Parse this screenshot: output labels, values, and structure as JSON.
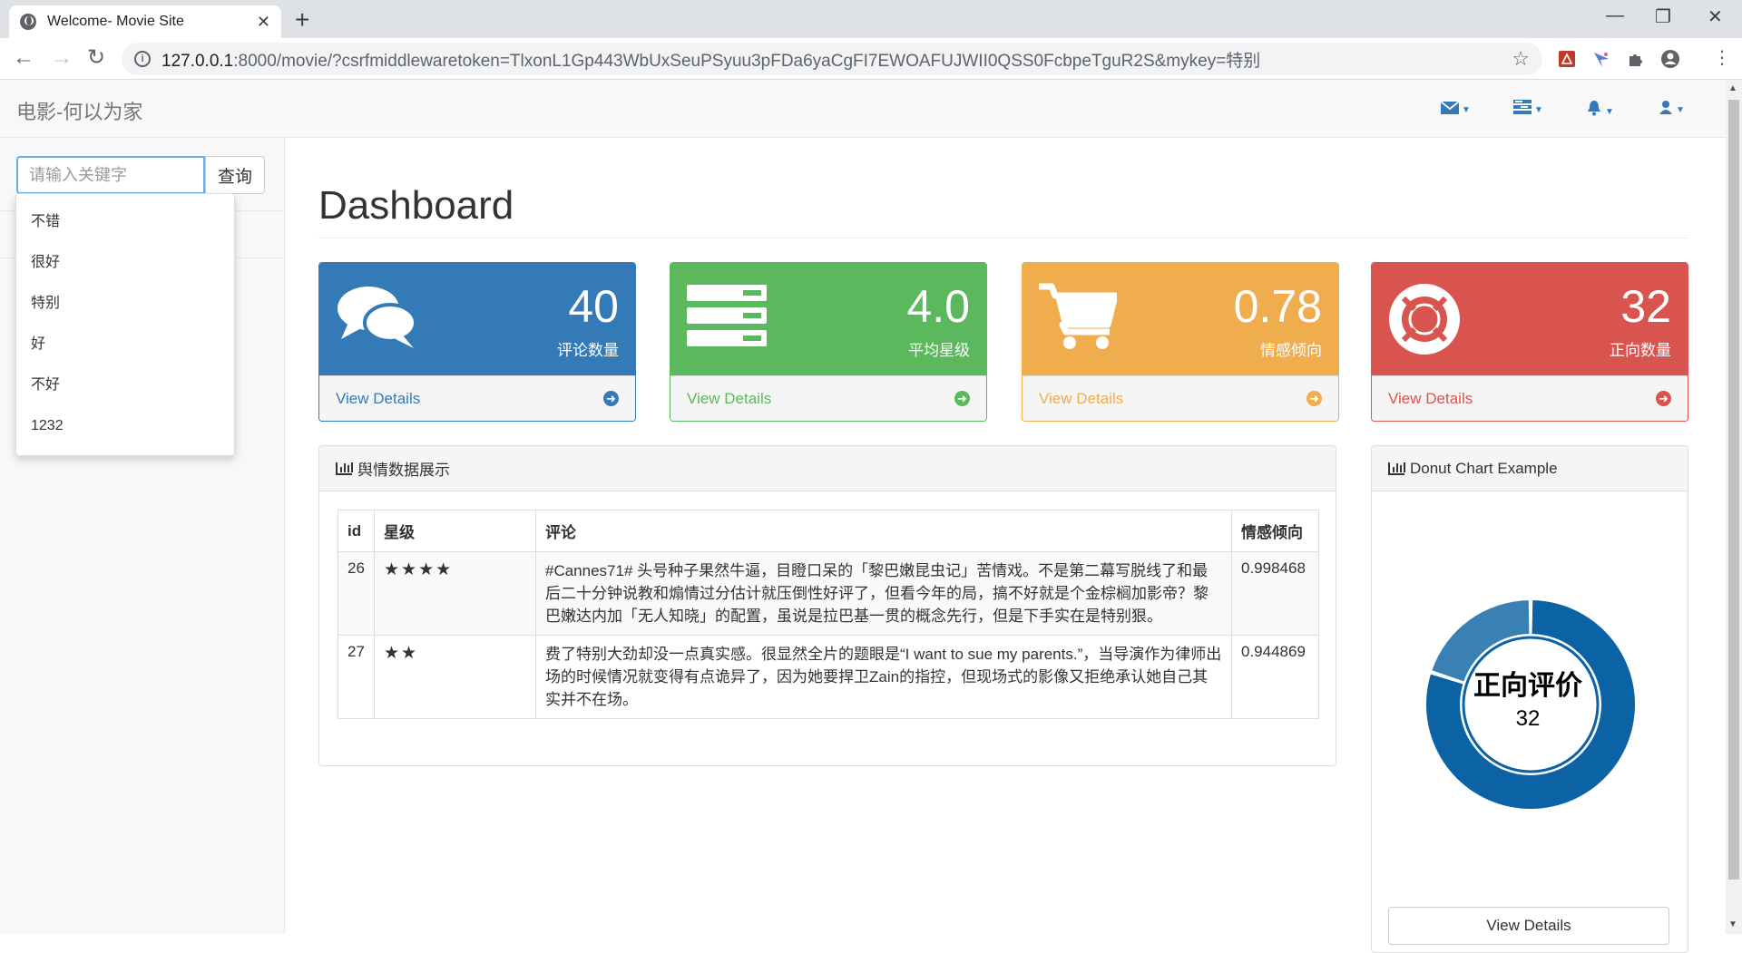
{
  "browser": {
    "tab_title": "Welcome- Movie Site",
    "tab_close": "✕",
    "new_tab": "+",
    "url_host": "127.0.0.1",
    "url_rest": ":8000/movie/?csrfmiddlewaretoken=TlxonL1Gp443WbUxSeuPSyuu3pFDa6yaCgFI7EWOAFUJWII0QSS0FcbpeTguR2S&mykey=特别",
    "minimize": "—",
    "maximize": "❐",
    "close": "✕"
  },
  "navbar": {
    "brand": "电影-何以为家",
    "icons": [
      "envelope-icon",
      "tasks-icon",
      "bell-icon",
      "user-icon"
    ]
  },
  "search": {
    "placeholder": "请输入关键字",
    "button_label": "查询",
    "suggestions": [
      "不错",
      "很好",
      "特别",
      "好",
      "不好",
      "1232"
    ]
  },
  "page_title": "Dashboard",
  "stats": [
    {
      "value": "40",
      "label": "评论数量",
      "link": "View Details",
      "color": "#337ab7",
      "icon": "comments-icon"
    },
    {
      "value": "4.0",
      "label": "平均星级",
      "link": "View Details",
      "color": "#5cb85c",
      "icon": "tasks-icon"
    },
    {
      "value": "0.78",
      "label": "情感倾向",
      "link": "View Details",
      "color": "#f0ad4e",
      "icon": "shopping-cart-icon"
    },
    {
      "value": "32",
      "label": "正向数量",
      "link": "View Details",
      "color": "#d9534f",
      "icon": "life-ring-icon"
    }
  ],
  "table_panel": {
    "heading": "舆情数据展示",
    "columns": [
      "id",
      "星级",
      "评论",
      "情感倾向"
    ],
    "rows": [
      {
        "id": "26",
        "stars": 4,
        "comment": "#Cannes71# 头号种子果然牛逼，目瞪口呆的「黎巴嫩昆虫记」苦情戏。不是第二幕写脱线了和最后二十分钟说教和煽情过分估计就压倒性好评了，但看今年的局，搞不好就是个金棕榈加影帝？黎巴嫩达内加「无人知晓」的配置，虽说是拉巴基一贯的概念先行，但是下手实在是特别狠。",
        "sentiment": "0.998468"
      },
      {
        "id": "27",
        "stars": 2,
        "comment": "费了特别大劲却没一点真实感。很显然全片的题眼是“I want to sue my parents.”，当导演作为律师出场的时候情况就变得有点诡异了，因为她要捍卫Zain的指控，但现场式的影像又拒绝承认她自己其实并不在场。",
        "sentiment": "0.944869"
      }
    ]
  },
  "donut_panel": {
    "heading": "Donut Chart Example",
    "button_label": "View Details"
  },
  "chart_data": {
    "type": "pie",
    "donut": true,
    "center_label": "正向评价",
    "center_value": "32",
    "slices": [
      {
        "value": 32,
        "color": "#0b62a4"
      },
      {
        "value": 8,
        "color": "#3980b5"
      }
    ]
  }
}
